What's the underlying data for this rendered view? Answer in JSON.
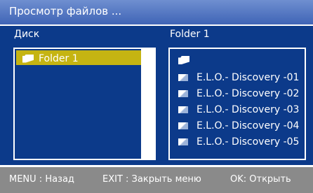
{
  "window": {
    "title": "Просмотр файлов ..."
  },
  "left_panel": {
    "header": "Диск",
    "items": [
      {
        "label": "Folder 1",
        "icon": "folder-icon",
        "selected": true
      }
    ]
  },
  "right_panel": {
    "header": "Folder 1",
    "files": [
      {
        "label": "E.L.O.- Discovery -01",
        "icon": "music-file-icon"
      },
      {
        "label": "E.L.O.- Discovery -02",
        "icon": "music-file-icon"
      },
      {
        "label": "E.L.O.- Discovery -03",
        "icon": "music-file-icon"
      },
      {
        "label": "E.L.O.- Discovery -04",
        "icon": "music-file-icon"
      },
      {
        "label": "E.L.O.- Discovery -05",
        "icon": "music-file-icon"
      }
    ]
  },
  "footer": {
    "menu_hint": "MENU : Назад",
    "exit_hint": "EXIT : Закрыть меню",
    "ok_hint": "OK:  Открыть"
  },
  "colors": {
    "title_bar": "#4f72c0",
    "background": "#0c3a8a",
    "selection": "#c5b412",
    "footer": "#8a8a8a"
  }
}
